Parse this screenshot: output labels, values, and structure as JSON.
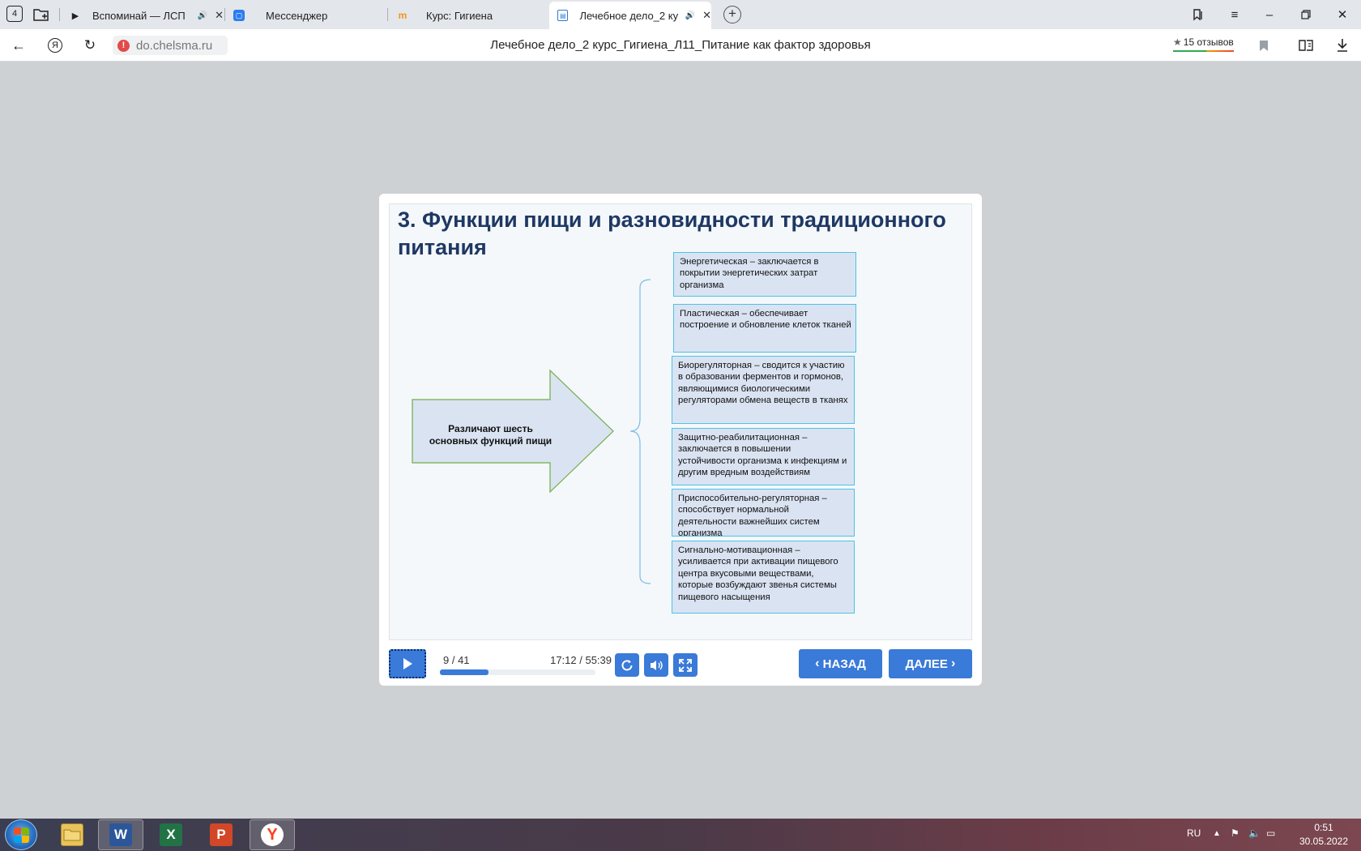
{
  "browser": {
    "tab_count": "4",
    "tabs": [
      {
        "title": "Вспоминай — ЛСП",
        "favicon": "play-icon"
      },
      {
        "title": "Мессенджер",
        "favicon": "messenger-icon"
      },
      {
        "title": "Курс: Гигиена",
        "favicon": "moodle-icon"
      },
      {
        "title": "Лечебное дело_2 ку",
        "favicon": "slides-icon"
      }
    ],
    "url": "do.chelsma.ru",
    "page_title": "Лечебное дело_2 курс_Гигиена_Л11_Питание как фактор здоровья",
    "reviews": "15 отзывов"
  },
  "slide": {
    "title": "3. Функции пищи и разновидности традиционного питания",
    "arrow_label": "Различают шесть основных функций пищи",
    "functions": [
      "Энергетическая – заключается в покрытии энергетических затрат организма",
      "Пластическая – обеспечивает построение и обновление клеток тканей",
      "Биорегуляторная – сводится к участию в образовании ферментов и гормонов, являющимися биологическими регуляторами обмена веществ в тканях",
      "Защитно-реабилитационная – заключается в повышении устойчивости организма к инфекциям и другим вредным воздействиям",
      "Приспособительно-регуляторная – способствует нормальной деятельности важнейших систем организма",
      "Сигнально-мотивационная – усиливается при активации пищевого центра вкусовыми веществами, которые возбуждают звенья системы пищевого насыщения"
    ],
    "colors": {
      "title": "#1f3864",
      "box_fill": "#dae3f2",
      "box_border": "#4cc3e8",
      "arrow_border": "#70ad47",
      "accent": "#3a7ad8"
    }
  },
  "player": {
    "slide_counter": "9 / 41",
    "time": "17:12 / 55:39",
    "progress": 0.31,
    "back_label": "НАЗАД",
    "next_label": "ДАЛЕЕ"
  },
  "taskbar": {
    "apps": [
      "explorer-icon",
      "word-icon",
      "excel-icon",
      "powerpoint-icon",
      "yandex-browser-icon"
    ],
    "lang": "RU",
    "time": "0:51",
    "date": "30.05.2022"
  }
}
